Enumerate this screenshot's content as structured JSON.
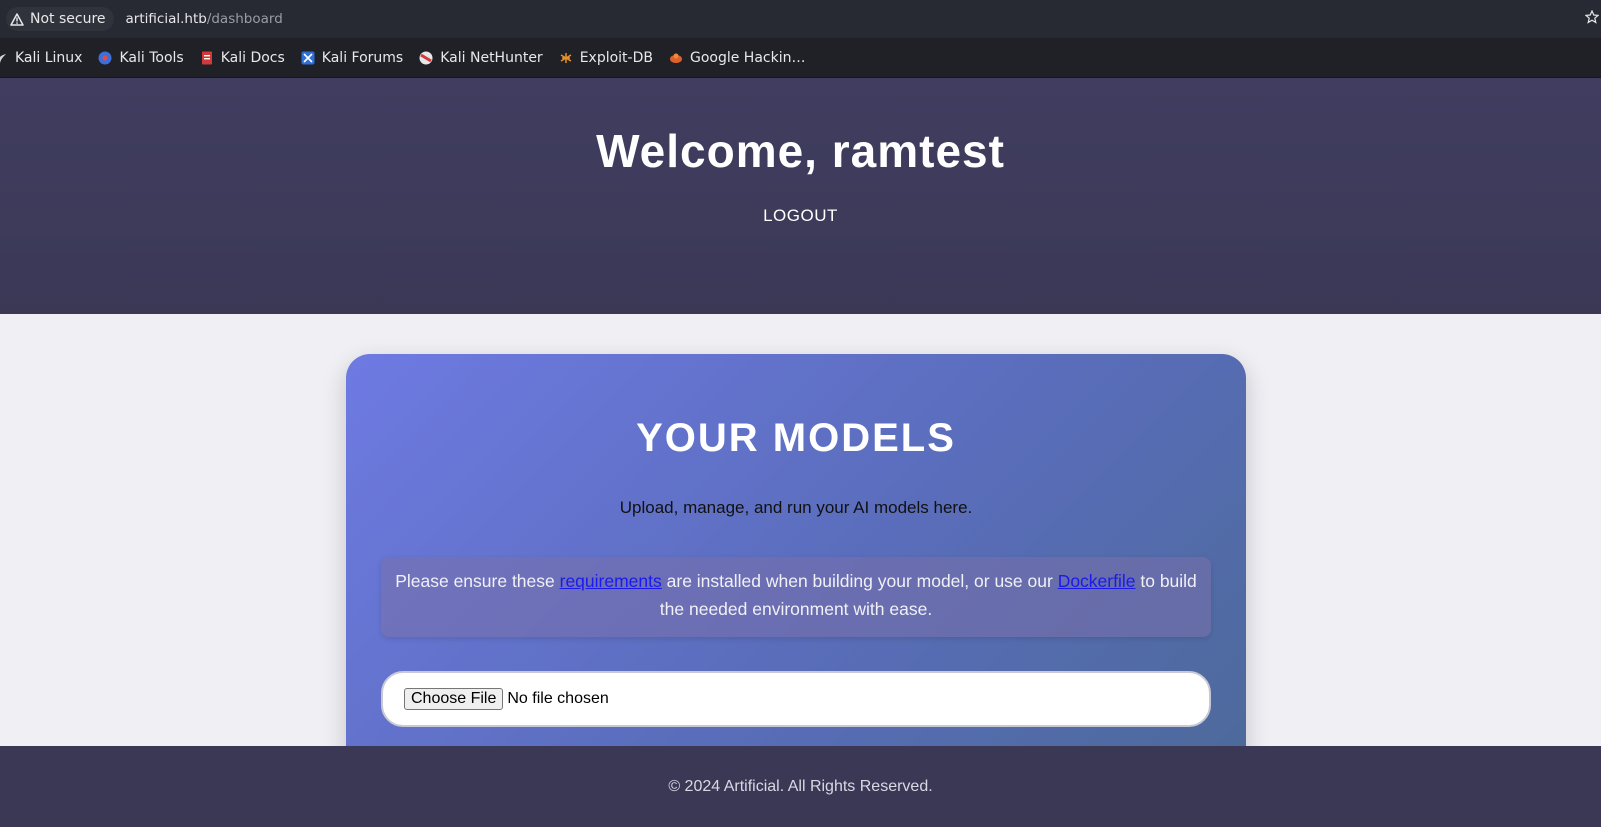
{
  "browser": {
    "security_label": "Not secure",
    "url_host": "artificial.htb",
    "url_path": "/dashboard",
    "bookmarks": [
      {
        "label": "Kali Linux",
        "icon": "kali-dragon-icon"
      },
      {
        "label": "Kali Tools",
        "icon": "kali-tools-icon"
      },
      {
        "label": "Kali Docs",
        "icon": "kali-docs-icon"
      },
      {
        "label": "Kali Forums",
        "icon": "kali-forums-icon"
      },
      {
        "label": "Kali NetHunter",
        "icon": "kali-nethunter-icon"
      },
      {
        "label": "Exploit-DB",
        "icon": "exploit-db-icon"
      },
      {
        "label": "Google Hackin…",
        "icon": "ghdb-icon"
      }
    ]
  },
  "header": {
    "welcome": "Welcome, ramtest",
    "logout": "LOGOUT"
  },
  "models": {
    "title": "YOUR MODELS",
    "subtitle": "Upload, manage, and run your AI models here.",
    "notice": {
      "before": "Please ensure these ",
      "link1": "requirements",
      "middle": " are installed when building your model, or use our ",
      "link2": "Dockerfile",
      "after": " to build the needed environment with ease."
    },
    "upload": {
      "button": "Choose File",
      "status": "No file chosen"
    }
  },
  "footer": {
    "text": "© 2024 Artificial. All Rights Reserved."
  },
  "colors": {
    "header_bg": "#3d3a5a",
    "card_gradient_start": "#6e7ae2",
    "card_gradient_end": "#4c6a9a",
    "link": "#1a1aee"
  }
}
